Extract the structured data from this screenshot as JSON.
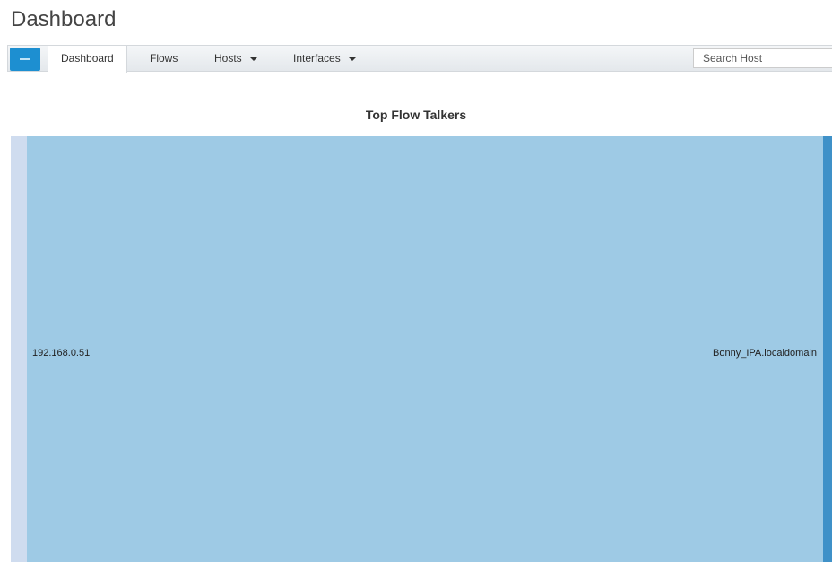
{
  "header": {
    "title": "Dashboard"
  },
  "nav": {
    "logo_icon": "ntop-logo-icon",
    "items": [
      {
        "label": "Dashboard",
        "active": true,
        "dropdown": false
      },
      {
        "label": "Flows",
        "active": false,
        "dropdown": false
      },
      {
        "label": "Hosts",
        "active": false,
        "dropdown": true
      },
      {
        "label": "Interfaces",
        "active": false,
        "dropdown": true
      }
    ],
    "search": {
      "placeholder": "Search Host",
      "value": ""
    }
  },
  "chart_data": {
    "type": "sankey",
    "title": "Top Flow Talkers",
    "nodes": [
      {
        "label": "192.168.0.51",
        "side": "left"
      },
      {
        "label": "Bonny_IPA.localdomain",
        "side": "right"
      }
    ],
    "links": [
      {
        "source": "192.168.0.51",
        "target": "Bonny_IPA.localdomain",
        "value": 1
      }
    ],
    "colors": {
      "left_node": "#cfdcef",
      "right_node": "#3f91c8",
      "link": "#9ecae5"
    }
  }
}
